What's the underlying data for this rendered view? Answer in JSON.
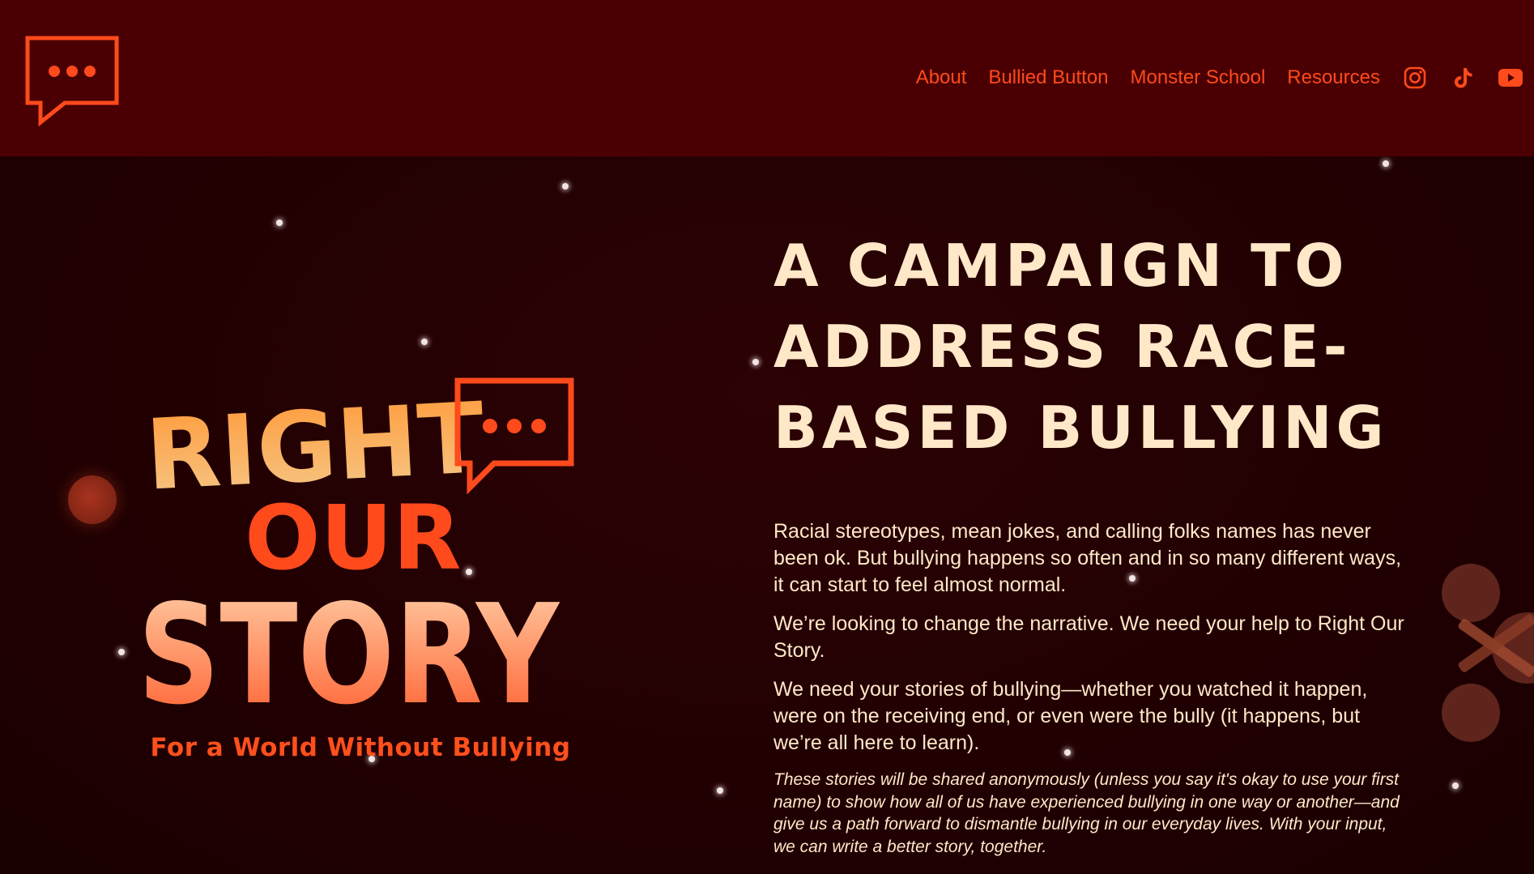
{
  "header": {
    "logo_icon": "speech-bubble-dots-icon",
    "nav": [
      {
        "label": "About"
      },
      {
        "label": "Bullied Button"
      },
      {
        "label": "Monster School"
      },
      {
        "label": "Resources"
      }
    ],
    "social": [
      "instagram-icon",
      "tiktok-icon",
      "youtube-icon"
    ]
  },
  "hero": {
    "logo_lines": [
      "RIGHT",
      "OUR",
      "STORY"
    ],
    "tagline": "For a World Without Bullying"
  },
  "main": {
    "headline_lines": [
      "A CAMPAIGN TO",
      "ADDRESS RACE-",
      "BASED BULLYING"
    ],
    "paragraphs": [
      "Racial stereotypes, mean jokes, and calling folks names has never been ok. But bullying happens so often and in so many different ways, it can start to feel almost normal.",
      "We’re looking to change the narrative. We need your help to Right Our Story.",
      "We need your stories of bullying—whether you watched it happen, were on the receiving end, or even were the bully (it happens, but we’re all here to learn)."
    ],
    "italic_paragraph": "These stories will be shared anonymously (unless you say it's okay to use your first name) to show how all of us have experienced bullying in one way or another—and give us a path forward to dismantle bullying in our everyday lives. With your input, we can write a better story, together."
  },
  "colors": {
    "header_bg": "#4a0002",
    "page_bg": "#230000",
    "accent": "#ff4a1c",
    "cream": "#ffe8c8"
  }
}
